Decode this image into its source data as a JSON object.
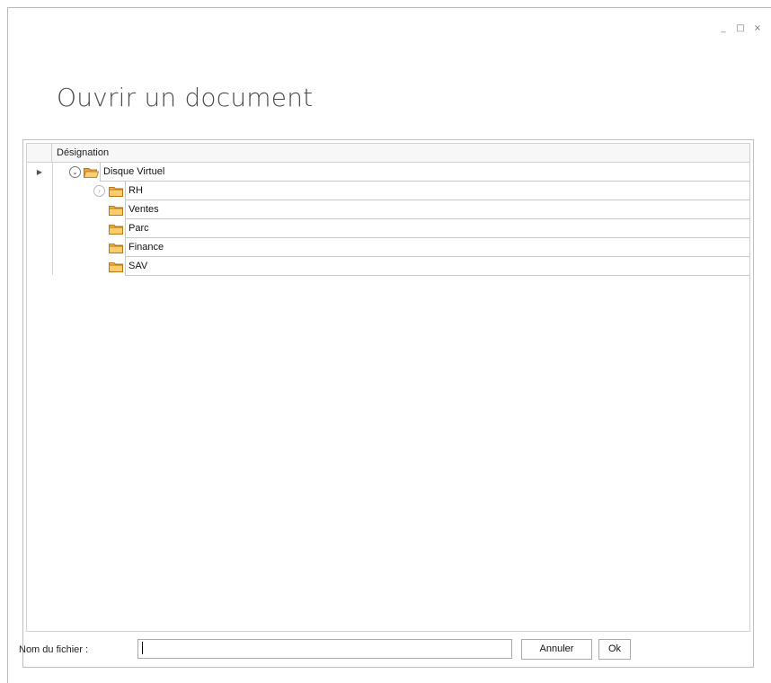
{
  "window": {
    "title": "Ouvrir un document",
    "controls": {
      "minimize": "_",
      "maximize": "□",
      "close": "×"
    }
  },
  "tree": {
    "column_header": "Désignation",
    "rows": [
      {
        "label": "Disque Virtuel",
        "level": 0,
        "expanded": true,
        "focused": true,
        "icon": "folder-open-icon"
      },
      {
        "label": "RH",
        "level": 1,
        "expanded": false,
        "icon": "folder-icon"
      },
      {
        "label": "Ventes",
        "level": 1,
        "icon": "folder-icon"
      },
      {
        "label": "Parc",
        "level": 1,
        "icon": "folder-icon"
      },
      {
        "label": "Finance",
        "level": 1,
        "icon": "folder-icon"
      },
      {
        "label": "SAV",
        "level": 1,
        "icon": "folder-icon"
      }
    ]
  },
  "footer": {
    "file_label": "Nom du fichier :",
    "file_value": "",
    "cancel_label": "Annuler",
    "ok_label": "Ok"
  },
  "colors": {
    "folder": "#f0a830",
    "border": "#bfbfbf",
    "title_text": "#4b4b4b"
  }
}
